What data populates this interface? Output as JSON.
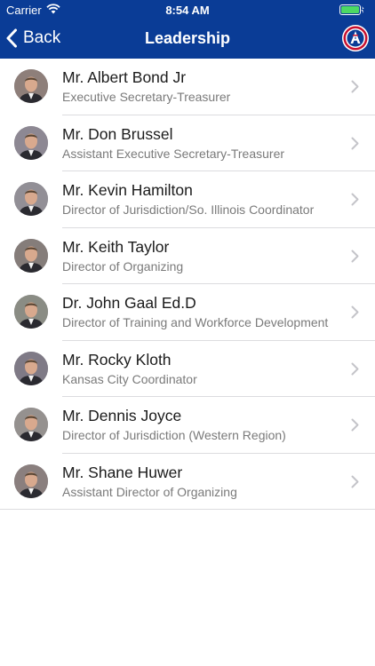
{
  "status_bar": {
    "carrier": "Carrier",
    "time": "8:54 AM"
  },
  "nav": {
    "back_label": "Back",
    "title": "Leadership"
  },
  "colors": {
    "header_bg": "#0a3c96",
    "battery": "#4cd964"
  },
  "leaders": [
    {
      "name": "Mr. Albert Bond Jr",
      "title": "Executive Secretary-Treasurer"
    },
    {
      "name": "Mr. Don Brussel",
      "title": "Assistant Executive Secretary-Treasurer"
    },
    {
      "name": "Mr. Kevin Hamilton",
      "title": "Director of Jurisdiction/So. Illinois Coordinator"
    },
    {
      "name": "Mr. Keith Taylor",
      "title": "Director of Organizing"
    },
    {
      "name": "Dr. John Gaal Ed.D",
      "title": "Director of Training and Workforce Development"
    },
    {
      "name": "Mr. Rocky Kloth",
      "title": "Kansas City Coordinator"
    },
    {
      "name": "Mr. Dennis Joyce",
      "title": "Director of Jurisdiction (Western Region)"
    },
    {
      "name": "Mr. Shane Huwer",
      "title": "Assistant Director of Organizing"
    }
  ]
}
